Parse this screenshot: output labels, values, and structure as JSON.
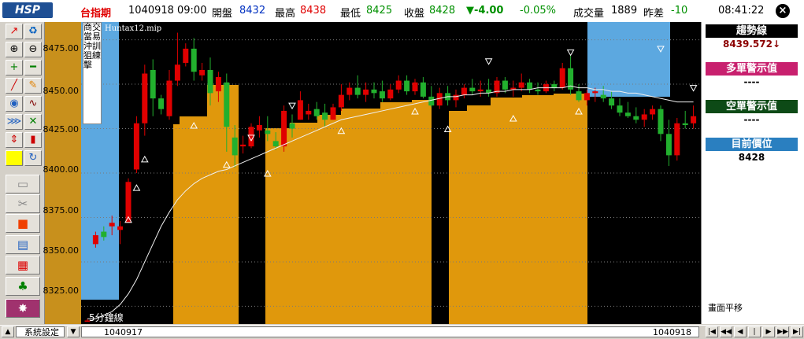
{
  "header": {
    "logo": "HSP",
    "symbol": "台指期",
    "date": "1040918",
    "time": "09:00",
    "open_label": "開盤",
    "open": "8432",
    "high_label": "最高",
    "high": "8438",
    "low_label": "最低",
    "low": "8425",
    "close_label": "收盤",
    "close": "8428",
    "change": "▼-4.00",
    "change_pct": "-0.05%",
    "volume_label": "成交量",
    "volume": "1889",
    "prev_diff_label": "昨差",
    "prev_diff": "-10",
    "clock": "08:41:22"
  },
  "chart": {
    "strategy_name": "Huntax12.mip",
    "vertical_tag_1": "商當沖狙擊",
    "vertical_tag_2": "交易訓練",
    "interval_label": "5分鐘線",
    "y_ticks": [
      "8475.00",
      "8450.00",
      "8425.00",
      "8400.00",
      "8375.00",
      "8350.00",
      "8325.00"
    ],
    "start_date": "1040917",
    "end_date": "1040918"
  },
  "side": {
    "trend_title": "趨勢線",
    "trend_value": "8439.572↓",
    "long_title": "多單警示值",
    "long_value": "----",
    "short_title": "空單警示值",
    "short_value": "----",
    "pos_title": "目前價位",
    "pos_value": "8428",
    "pan_label": "畫面平移",
    "colors": {
      "trend": "#000000",
      "long": "#c8206e",
      "short": "#0d4a16",
      "pos": "#2a7fc0"
    }
  },
  "bottom": {
    "settings": "系統設定"
  },
  "chart_data": {
    "type": "candlestick",
    "ylim": [
      8315,
      8485
    ],
    "candles": [
      [
        8317,
        8318,
        8317,
        8317
      ],
      [
        8360,
        8367,
        8358,
        8365
      ],
      [
        8367,
        8370,
        8362,
        8364
      ],
      [
        8370,
        8376,
        8365,
        8372
      ],
      [
        8368,
        8373,
        8360,
        8370
      ],
      [
        8372,
        8397,
        8372,
        8395
      ],
      [
        8402,
        8432,
        8400,
        8428
      ],
      [
        8428,
        8461,
        8421,
        8456
      ],
      [
        8458,
        8464,
        8432,
        8442
      ],
      [
        8442,
        8444,
        8433,
        8436
      ],
      [
        8432,
        8458,
        8430,
        8452
      ],
      [
        8452,
        8479,
        8449,
        8461
      ],
      [
        8462,
        8473,
        8460,
        8470
      ],
      [
        8470,
        8476,
        8452,
        8457
      ],
      [
        8455,
        8462,
        8452,
        8458
      ],
      [
        8458,
        8465,
        8438,
        8445
      ],
      [
        8446,
        8457,
        8440,
        8454
      ],
      [
        8451,
        8456,
        8412,
        8426
      ],
      [
        8420,
        8427,
        8403,
        8410
      ],
      [
        8415,
        8421,
        8411,
        8416
      ],
      [
        8415,
        8428,
        8414,
        8426
      ],
      [
        8424,
        8432,
        8420,
        8427
      ],
      [
        8424,
        8432,
        8418,
        8422
      ],
      [
        8418,
        8423,
        8413,
        8415
      ],
      [
        8415,
        8438,
        8412,
        8435
      ],
      [
        8428,
        8433,
        8420,
        8425
      ],
      [
        8430,
        8446,
        8430,
        8441
      ],
      [
        8433,
        8439,
        8430,
        8435
      ],
      [
        8436,
        8440,
        8430,
        8432
      ],
      [
        8434,
        8439,
        8426,
        8430
      ],
      [
        8430,
        8439,
        8430,
        8437
      ],
      [
        8437,
        8450,
        8435,
        8444
      ],
      [
        8444,
        8451,
        8441,
        8448
      ],
      [
        8448,
        8455,
        8442,
        8444
      ],
      [
        8444,
        8451,
        8440,
        8447
      ],
      [
        8447,
        8451,
        8442,
        8445
      ],
      [
        8446,
        8452,
        8440,
        8442
      ],
      [
        8442,
        8450,
        8441,
        8447
      ],
      [
        8447,
        8455,
        8445,
        8452
      ],
      [
        8452,
        8455,
        8444,
        8446
      ],
      [
        8446,
        8453,
        8444,
        8451
      ],
      [
        8451,
        8454,
        8442,
        8443
      ],
      [
        8443,
        8449,
        8437,
        8438
      ],
      [
        8438,
        8448,
        8436,
        8445
      ],
      [
        8445,
        8449,
        8438,
        8441
      ],
      [
        8441,
        8447,
        8437,
        8444
      ],
      [
        8444,
        8450,
        8442,
        8448
      ],
      [
        8448,
        8453,
        8444,
        8446
      ],
      [
        8446,
        8452,
        8443,
        8447
      ],
      [
        8447,
        8453,
        8443,
        8445
      ],
      [
        8445,
        8454,
        8443,
        8452
      ],
      [
        8452,
        8454,
        8445,
        8447
      ],
      [
        8447,
        8452,
        8443,
        8448
      ],
      [
        8448,
        8456,
        8446,
        8451
      ],
      [
        8451,
        8453,
        8445,
        8447
      ],
      [
        8447,
        8451,
        8444,
        8446
      ],
      [
        8446,
        8452,
        8445,
        8450
      ],
      [
        8450,
        8452,
        8446,
        8448
      ],
      [
        8448,
        8462,
        8447,
        8459
      ],
      [
        8459,
        8466,
        8444,
        8447
      ],
      [
        8446,
        8450,
        8440,
        8441
      ],
      [
        8441,
        8447,
        8438,
        8445
      ],
      [
        8445,
        8448,
        8440,
        8446
      ],
      [
        8444,
        8449,
        8440,
        8442
      ],
      [
        8442,
        8446,
        8436,
        8438
      ],
      [
        8438,
        8442,
        8432,
        8434
      ],
      [
        8434,
        8440,
        8431,
        8432
      ],
      [
        8432,
        8437,
        8428,
        8430
      ],
      [
        8430,
        8436,
        8426,
        8433
      ],
      [
        8433,
        8438,
        8430,
        8436
      ],
      [
        8436,
        8438,
        8418,
        8422
      ],
      [
        8422,
        8430,
        8404,
        8410
      ],
      [
        8410,
        8431,
        8407,
        8428
      ],
      [
        8428,
        8435,
        8425,
        8427
      ],
      [
        8428,
        8438,
        8425,
        8432
      ]
    ],
    "trend_line": [
      8318,
      8318,
      8320,
      8322,
      8326,
      8332,
      8340,
      8350,
      8360,
      8370,
      8378,
      8385,
      8390,
      8394,
      8397,
      8399,
      8401,
      8402,
      8404,
      8406,
      8408,
      8410,
      8412,
      8414,
      8416,
      8418,
      8420,
      8422,
      8424,
      8426,
      8428,
      8430,
      8431,
      8432,
      8433,
      8434,
      8435,
      8436,
      8437,
      8438,
      8439,
      8440,
      8441,
      8442,
      8443,
      8443,
      8444,
      8444,
      8445,
      8445,
      8446,
      8446,
      8447,
      8447,
      8447,
      8448,
      8448,
      8448,
      8448,
      8449,
      8448,
      8448,
      8447,
      8447,
      8446,
      8446,
      8445,
      8445,
      8444,
      8443,
      8442,
      8441,
      8440,
      8440,
      8440
    ]
  }
}
